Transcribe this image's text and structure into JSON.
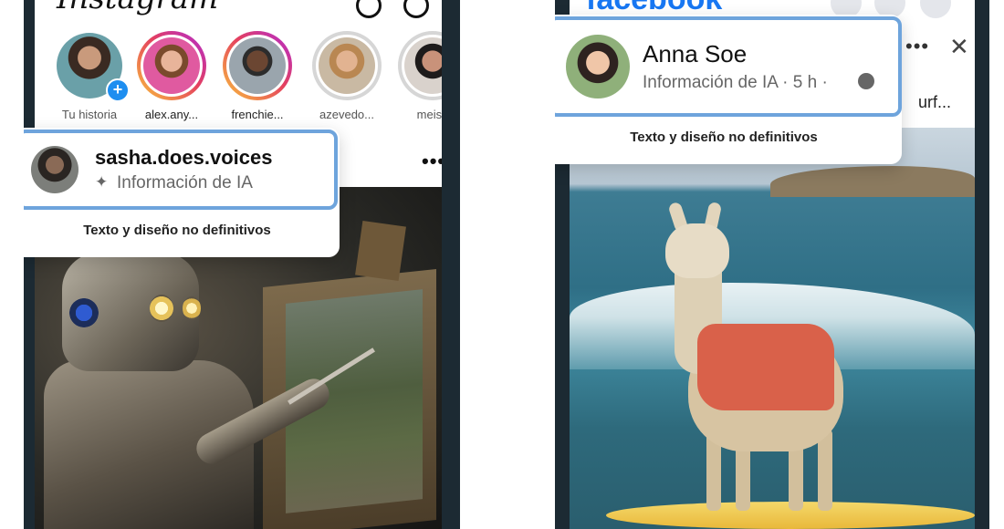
{
  "instagram": {
    "logo": "Instagram",
    "stories": [
      {
        "name": "Tu historia",
        "own": true
      },
      {
        "name": "alex.any..."
      },
      {
        "name": "frenchie..."
      },
      {
        "name": "azevedo..."
      },
      {
        "name": "meish"
      }
    ],
    "overlay": {
      "username": "sasha.does.voices",
      "label": "Información de IA",
      "label_icon": "sparkle-icon",
      "footer": "Texto y diseño no definitivos"
    },
    "more_icon": "more-horizontal-icon"
  },
  "facebook": {
    "logo": "facebook",
    "overlay": {
      "name": "Anna Soe",
      "meta": "Información de IA · 5 h ·",
      "meta_icon": "globe-icon",
      "footer": "Texto y diseño no definitivos"
    },
    "post_snippet": "urf...",
    "more_icon": "more-horizontal-icon",
    "close_icon": "close-icon"
  },
  "colors": {
    "highlight_border": "#6ea4dc",
    "facebook_blue": "#1877f2",
    "story_ring_gradient": [
      "#f9c23c",
      "#e4405f",
      "#b12bd2"
    ],
    "add_badge": "#1e8ef0"
  }
}
